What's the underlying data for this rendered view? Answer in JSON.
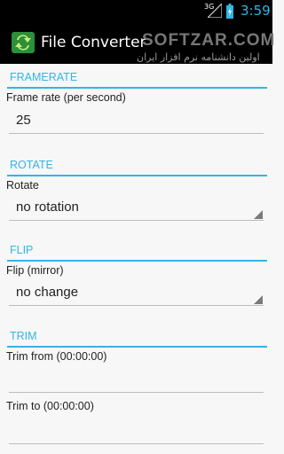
{
  "status_bar": {
    "network": "3G",
    "time": "3:59"
  },
  "action_bar": {
    "title": "File Converter"
  },
  "watermark": {
    "text": "SOFTZAR.COM",
    "subtext": "اولین دانشنامه نرم افزار ایران"
  },
  "sections": {
    "framerate": {
      "header": "FRAMERATE",
      "label": "Frame rate (per second)",
      "value": "25"
    },
    "rotate": {
      "header": "ROTATE",
      "label": "Rotate",
      "value": "no rotation"
    },
    "flip": {
      "header": "FLIP",
      "label": "Flip (mirror)",
      "value": "no change"
    },
    "trim": {
      "header": "TRIM",
      "from_label": "Trim from (00:00:00)",
      "from_value": "",
      "to_label": "Trim to (00:00:00)",
      "to_value": ""
    }
  },
  "colors": {
    "accent": "#33b5e5",
    "background": "#f7f7f7",
    "bar": "#000000"
  }
}
